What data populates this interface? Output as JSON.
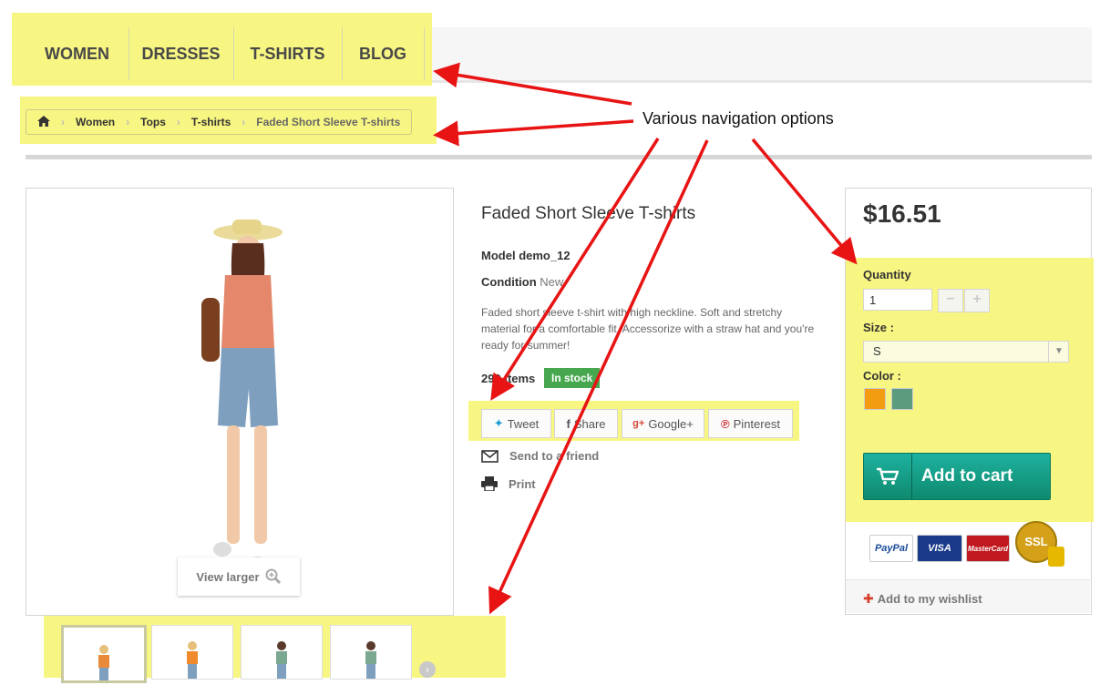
{
  "nav": {
    "items": [
      "WOMEN",
      "DRESSES",
      "T-SHIRTS",
      "BLOG"
    ]
  },
  "breadcrumb": {
    "items": [
      "Women",
      "Tops",
      "T-shirts",
      "Faded Short Sleeve T-shirts"
    ]
  },
  "product": {
    "title": "Faded Short Sleeve T-shirts",
    "model_label": "Model",
    "model_value": "demo_12",
    "condition_label": "Condition",
    "condition_value": "New",
    "description": "Faded short sleeve t-shirt with high neckline. Soft and stretchy material for a comfortable fit. Accessorize with a straw hat and you're ready for summer!",
    "quantity_count": "299",
    "items_label": "Items",
    "stock_status": "In stock",
    "view_larger": "View larger"
  },
  "share": {
    "tweet": "Tweet",
    "share": "Share",
    "google": "Google+",
    "pinterest": "Pinterest"
  },
  "links": {
    "send_friend": "Send to a friend",
    "print": "Print"
  },
  "buy": {
    "price": "$16.51",
    "quantity_label": "Quantity",
    "quantity_value": "1",
    "size_label": "Size :",
    "size_value": "S",
    "color_label": "Color :",
    "colors": [
      "#f39c11",
      "#5d9b7e"
    ],
    "add_to_cart": "Add to cart",
    "wishlist": "Add to my wishlist"
  },
  "payment": {
    "paypal": "PayPal",
    "visa": "VISA",
    "mastercard": "MasterCard",
    "ssl": "SSL"
  },
  "annotation": {
    "text": "Various navigation options"
  },
  "colors": {
    "highlight": "#f7f577",
    "accent_green": "#46a74e",
    "cart": "#14a087",
    "arrow": "#e81414"
  }
}
